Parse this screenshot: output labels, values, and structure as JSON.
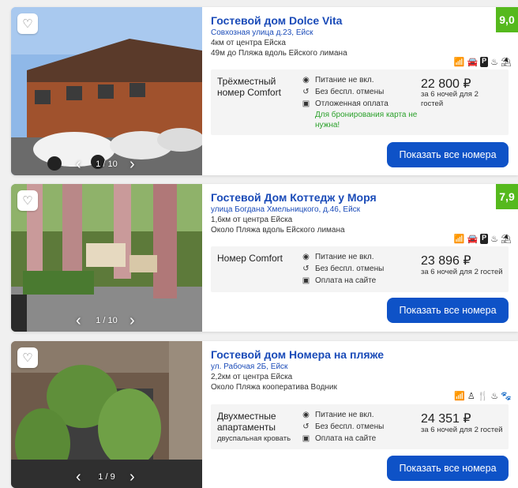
{
  "listings": [
    {
      "name": "Гостевой дом Dolce Vita",
      "address": "Совхозная улица д.23, Ейск",
      "distance_center": "4км от центра Ейска",
      "distance_beach": "49м до Пляжа вдоль Ейского лимана",
      "score": "9,0",
      "amenities": [
        "wifi-icon",
        "car-icon",
        "parking-icon",
        "cooking-icon",
        "beach-icon"
      ],
      "room_name": "Трёхместный номер Comfort",
      "room_sub": "",
      "conditions": [
        "Питание не вкл.",
        "Без беспл. отмены",
        "Отложенная оплата"
      ],
      "note": "Для бронирования карта не нужна!",
      "price": "22 800 ₽",
      "nights": "за 6 ночей для 2 гостей",
      "button": "Показать все номера",
      "pager": "1 / 10"
    },
    {
      "name": "Гостевой Дом Коттедж у Моря",
      "address": "улица Богдана Хмельницкого, д.46, Ейск",
      "distance_center": "1,6км от центра Ейска",
      "distance_beach": "Около Пляжа вдоль Ейского лимана",
      "score": "7,9",
      "amenities": [
        "wifi-icon",
        "car-icon",
        "parking-icon",
        "cooking-icon",
        "beach-icon"
      ],
      "room_name": "Номер Comfort",
      "room_sub": "",
      "conditions": [
        "Питание не вкл.",
        "Без беспл. отмены",
        "Оплата на сайте"
      ],
      "note": "",
      "price": "23 896 ₽",
      "nights": "за 6 ночей для 2 гостей",
      "button": "Показать все номера",
      "pager": "1 / 10"
    },
    {
      "name": "Гостевой дом Номера на пляже",
      "address": "ул. Рабочая 2Б, Ейск",
      "distance_center": "2,2км от центра Ейска",
      "distance_beach": "Около Пляжа кооператива Водник",
      "score": "",
      "amenities": [
        "wifi-icon",
        "kids-icon",
        "restaurant-icon",
        "cooking-icon",
        "pets-icon"
      ],
      "room_name": "Двухместные апартаменты",
      "room_sub": "двуспальная кровать",
      "conditions": [
        "Питание не вкл.",
        "Без беспл. отмены",
        "Оплата на сайте"
      ],
      "note": "",
      "price": "24 351 ₽",
      "nights": "за 6 ночей для 2 гостей",
      "button": "Показать все номера",
      "pager": "1 / 9"
    }
  ],
  "colors": {
    "accent": "#0e52c7",
    "score": "#55b91d",
    "link": "#1a4bb8",
    "note": "#2ba12b"
  }
}
